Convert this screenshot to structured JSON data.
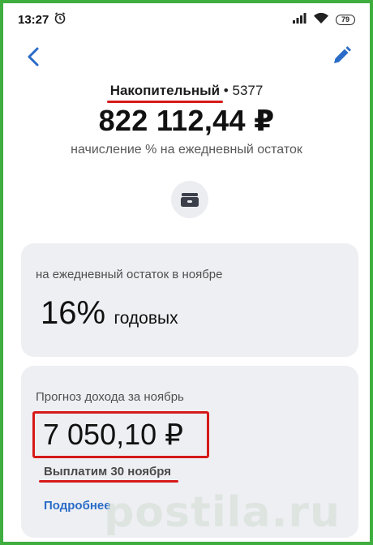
{
  "status_bar": {
    "time": "13:27",
    "battery": "79",
    "icons": [
      "alarm-icon",
      "signal-icon",
      "wifi-icon",
      "battery-icon"
    ]
  },
  "nav": {
    "back_icon": "chevron-left-icon",
    "edit_icon": "pencil-icon"
  },
  "account": {
    "name": "Накопительный",
    "separator": " • ",
    "number": "5377",
    "balance": "822 112,44 ₽",
    "note": "начисление % на ежедневный остаток"
  },
  "wallet_icon": "wallet-icon",
  "rate_card": {
    "label": "на ежедневный остаток в ноябре",
    "value": "16%",
    "unit": "годовых"
  },
  "forecast_card": {
    "label": "Прогноз дохода за ноябрь",
    "amount": "7 050,10 ₽",
    "payout": "Выплатим 30 ноября",
    "link": "Подробнее"
  },
  "watermark": "postila.ru",
  "colors": {
    "frame": "#3fae3f",
    "accent": "#2a6cc7",
    "highlight": "#d61a1a",
    "card_bg": "#eeeff3"
  }
}
